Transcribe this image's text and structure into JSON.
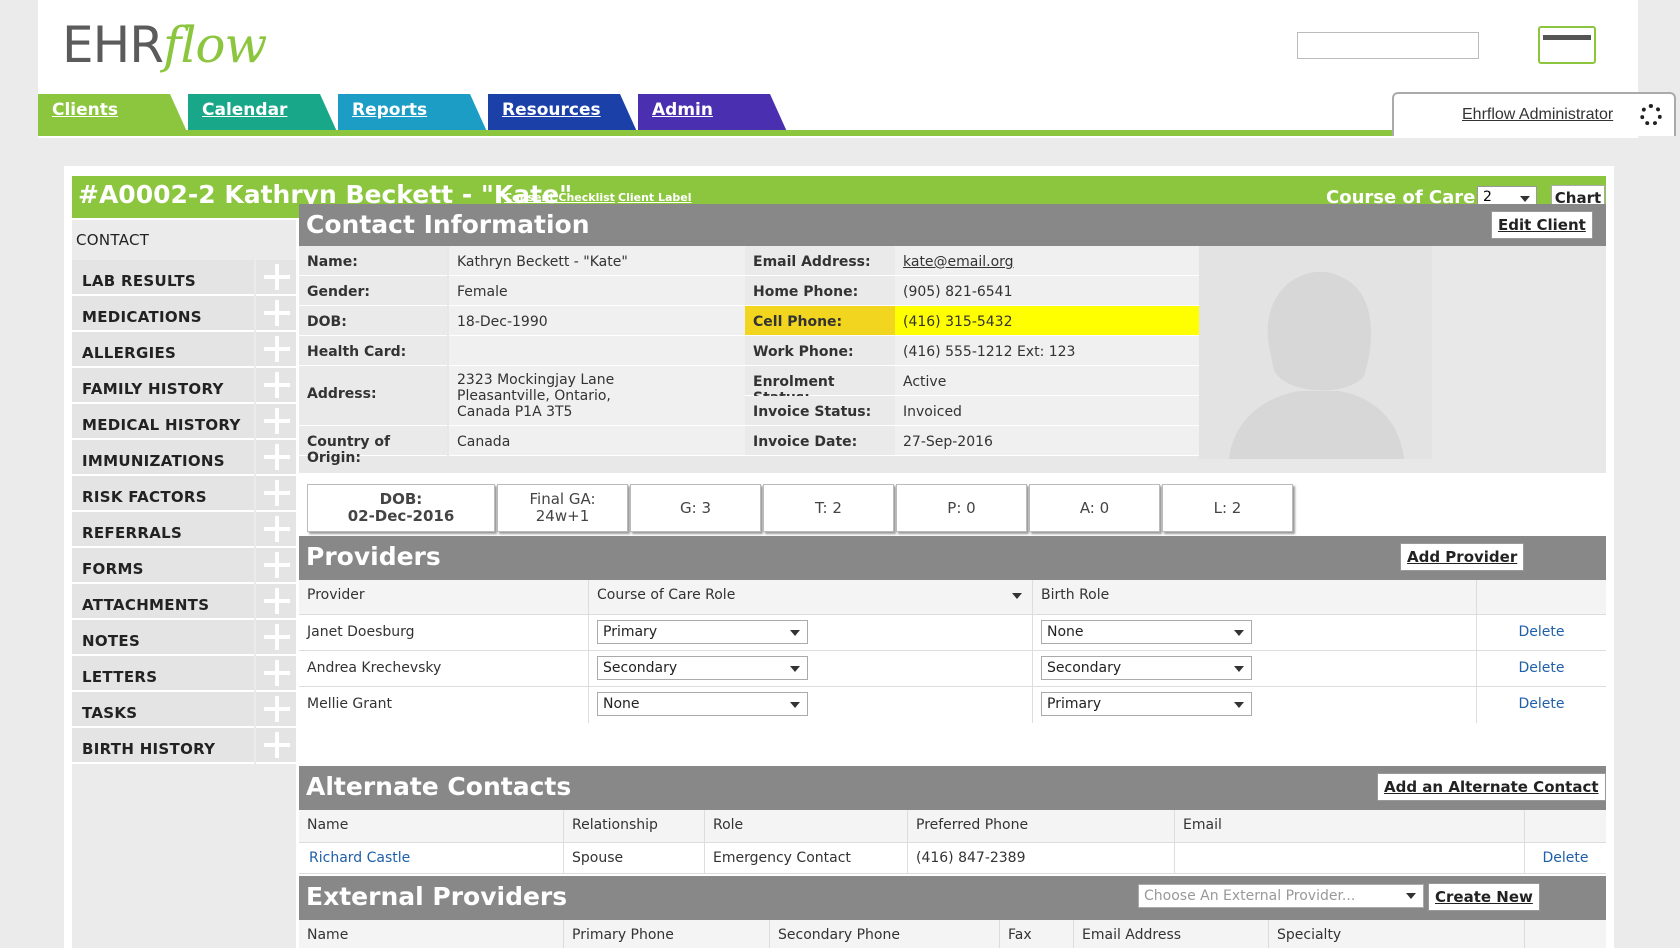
{
  "app": {
    "logo_main": "EHR",
    "logo_flow": "flow",
    "nav": [
      {
        "label": "Clients"
      },
      {
        "label": "Calendar"
      },
      {
        "label": "Reports"
      },
      {
        "label": "Resources"
      },
      {
        "label": "Admin"
      }
    ],
    "user": "Ehrflow Administrator"
  },
  "client": {
    "title": "#A0002-2 Kathryn Beckett - \"Kate\"",
    "consent_link": "Consent Checklist",
    "label_link": "Client Label",
    "course_label": "Course of Care:",
    "course_value": "2",
    "chart_button": "Chart"
  },
  "sidebar": [
    {
      "label": "CONTACT"
    },
    {
      "label": "LAB RESULTS"
    },
    {
      "label": "MEDICATIONS"
    },
    {
      "label": "ALLERGIES"
    },
    {
      "label": "FAMILY HISTORY"
    },
    {
      "label": "MEDICAL HISTORY"
    },
    {
      "label": "IMMUNIZATIONS"
    },
    {
      "label": "RISK FACTORS"
    },
    {
      "label": "REFERRALS"
    },
    {
      "label": "FORMS"
    },
    {
      "label": "ATTACHMENTS"
    },
    {
      "label": "NOTES"
    },
    {
      "label": "LETTERS"
    },
    {
      "label": "TASKS"
    },
    {
      "label": "BIRTH HISTORY"
    }
  ],
  "contact": {
    "title": "Contact Information",
    "edit_button": "Edit Client",
    "rows": [
      {
        "l1": "Name:",
        "v1": "Kathryn Beckett - \"Kate\"",
        "l2": "Email Address:",
        "v2": "kate@email.org"
      },
      {
        "l1": "Gender:",
        "v1": "Female",
        "l2": "Home Phone:",
        "v2": "(905) 821-6541"
      },
      {
        "l1": "DOB:",
        "v1": "18-Dec-1990",
        "l2": "Cell Phone:",
        "v2": "(416) 315-5432"
      },
      {
        "l1": "Health Card:",
        "v1": "",
        "l2": "Work Phone:",
        "v2": "(416) 555-1212 Ext: 123"
      },
      {
        "l1": "Address:",
        "v1a": "2323 Mockingjay Lane",
        "v1b": "Pleasantville, Ontario,",
        "v1c": "Canada P1A 3T5",
        "l2": "Enrolment Status:",
        "v2": "Active",
        "l2b": "Invoice Status:",
        "v2b": "Invoiced"
      },
      {
        "l1": "Country of Origin:",
        "v1": "Canada",
        "l2": "Invoice Date:",
        "v2": "27-Sep-2016"
      }
    ]
  },
  "stats": {
    "dob_label": "DOB:",
    "dob_value": "02-Dec-2016",
    "ga_label": "Final GA:",
    "ga_value": "24w+1",
    "g": "G: 3",
    "t": "T: 2",
    "p": "P: 0",
    "a": "A: 0",
    "l": "L: 2"
  },
  "providers": {
    "title": "Providers",
    "add_button": "Add Provider",
    "headers": [
      "Provider",
      "Course of Care Role",
      "Birth Role"
    ],
    "rows": [
      {
        "name": "Janet Doesburg",
        "role": "Primary",
        "birth": "None",
        "action": "Delete"
      },
      {
        "name": "Andrea Krechevsky",
        "role": "Secondary",
        "birth": "Secondary",
        "action": "Delete"
      },
      {
        "name": "Mellie Grant",
        "role": "None",
        "birth": "Primary",
        "action": "Delete"
      }
    ]
  },
  "alternate": {
    "title": "Alternate Contacts",
    "add_button": "Add an Alternate Contact",
    "headers": [
      "Name",
      "Relationship",
      "Role",
      "Preferred Phone",
      "Email"
    ],
    "rows": [
      {
        "name": "Richard Castle",
        "relationship": "Spouse",
        "role": "Emergency Contact",
        "phone": "(416) 847-2389",
        "email": "",
        "action": "Delete"
      }
    ]
  },
  "external": {
    "title": "External Providers",
    "select_placeholder": "Choose An External Provider...",
    "create_button": "Create New",
    "headers": [
      "Name",
      "Primary Phone",
      "Secondary Phone",
      "Fax",
      "Email Address",
      "Specialty"
    ]
  },
  "colors": {
    "brand_green": "#8cc63f",
    "section_gray": "#888888",
    "highlight_yellow": "#ffff00"
  }
}
